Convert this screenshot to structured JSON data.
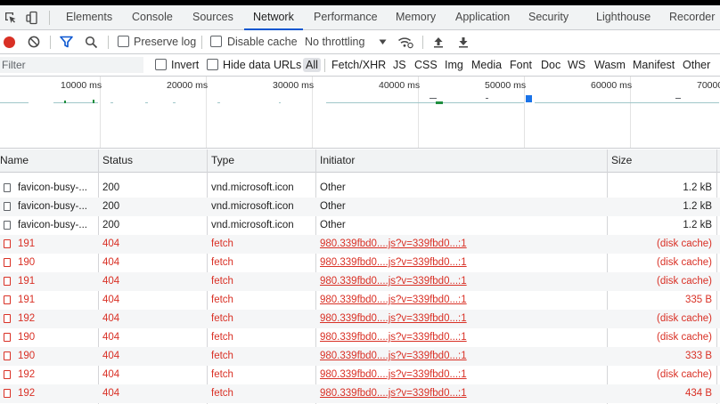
{
  "tabs": [
    {
      "label": "Elements",
      "active": false
    },
    {
      "label": "Console",
      "active": false
    },
    {
      "label": "Sources",
      "active": false
    },
    {
      "label": "Network",
      "active": true
    },
    {
      "label": "Performance",
      "active": false
    },
    {
      "label": "Memory",
      "active": false
    },
    {
      "label": "Application",
      "active": false
    },
    {
      "label": "Security",
      "active": false
    },
    {
      "label": "Lighthouse",
      "active": false
    },
    {
      "label": "Recorder",
      "active": false
    }
  ],
  "toolbar": {
    "preserve_log_label": "Preserve log",
    "disable_cache_label": "Disable cache",
    "throttling_value": "No throttling",
    "record_color": "#d93025",
    "accent_color": "#0b57d0"
  },
  "filter": {
    "placeholder": "Filter",
    "invert_label": "Invert",
    "hide_data_urls_label": "Hide data URLs",
    "types": [
      "All",
      "Fetch/XHR",
      "JS",
      "CSS",
      "Img",
      "Media",
      "Font",
      "Doc",
      "WS",
      "Wasm",
      "Manifest",
      "Other"
    ],
    "selected_type": "All"
  },
  "overview": {
    "ticks": [
      "10000 ms",
      "20000 ms",
      "30000 ms",
      "40000 ms",
      "50000 ms",
      "60000 ms",
      "70000"
    ]
  },
  "table": {
    "columns": [
      "Name",
      "Status",
      "Type",
      "Initiator",
      "Size"
    ],
    "rows": [
      {
        "name": "favicon-busy-...",
        "status": "200",
        "type": "vnd.microsoft.icon",
        "initiator": "Other",
        "size": "1.2 kB",
        "error": false
      },
      {
        "name": "favicon-busy-...",
        "status": "200",
        "type": "vnd.microsoft.icon",
        "initiator": "Other",
        "size": "1.2 kB",
        "error": false
      },
      {
        "name": "favicon-busy-...",
        "status": "200",
        "type": "vnd.microsoft.icon",
        "initiator": "Other",
        "size": "1.2 kB",
        "error": false
      },
      {
        "name": "191",
        "status": "404",
        "type": "fetch",
        "initiator": "980.339fbd0....js?v=339fbd0...:1",
        "size": "(disk cache)",
        "error": true
      },
      {
        "name": "190",
        "status": "404",
        "type": "fetch",
        "initiator": "980.339fbd0....js?v=339fbd0...:1",
        "size": "(disk cache)",
        "error": true
      },
      {
        "name": "191",
        "status": "404",
        "type": "fetch",
        "initiator": "980.339fbd0....js?v=339fbd0...:1",
        "size": "(disk cache)",
        "error": true
      },
      {
        "name": "191",
        "status": "404",
        "type": "fetch",
        "initiator": "980.339fbd0....js?v=339fbd0...:1",
        "size": "335 B",
        "error": true
      },
      {
        "name": "192",
        "status": "404",
        "type": "fetch",
        "initiator": "980.339fbd0....js?v=339fbd0...:1",
        "size": "(disk cache)",
        "error": true
      },
      {
        "name": "190",
        "status": "404",
        "type": "fetch",
        "initiator": "980.339fbd0....js?v=339fbd0...:1",
        "size": "(disk cache)",
        "error": true
      },
      {
        "name": "190",
        "status": "404",
        "type": "fetch",
        "initiator": "980.339fbd0....js?v=339fbd0...:1",
        "size": "333 B",
        "error": true
      },
      {
        "name": "192",
        "status": "404",
        "type": "fetch",
        "initiator": "980.339fbd0....js?v=339fbd0...:1",
        "size": "(disk cache)",
        "error": true
      },
      {
        "name": "192",
        "status": "404",
        "type": "fetch",
        "initiator": "980.339fbd0....js?v=339fbd0...:1",
        "size": "434 B",
        "error": true
      }
    ]
  }
}
